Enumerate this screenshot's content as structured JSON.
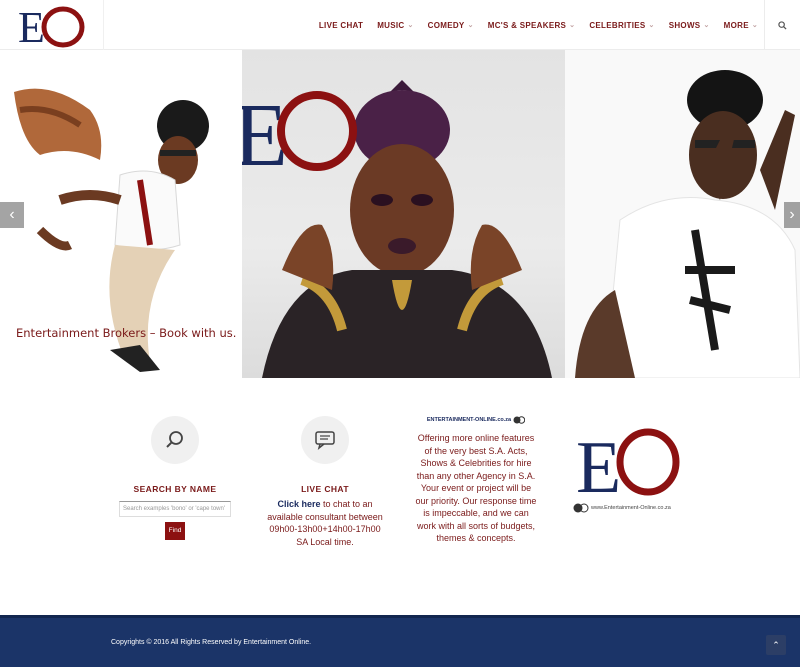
{
  "header": {
    "nav": [
      {
        "label": "LIVE CHAT",
        "has_dropdown": false
      },
      {
        "label": "MUSIC",
        "has_dropdown": true
      },
      {
        "label": "COMEDY",
        "has_dropdown": true
      },
      {
        "label": "MC'S & SPEAKERS",
        "has_dropdown": true
      },
      {
        "label": "CELEBRITIES",
        "has_dropdown": true
      },
      {
        "label": "SHOWS",
        "has_dropdown": true
      },
      {
        "label": "MORE",
        "has_dropdown": true
      }
    ],
    "search_icon": "search-icon",
    "logo_text": "EO"
  },
  "slider": {
    "caption": "Entertainment Brokers – Book with us.",
    "prev_icon": "chevron-left-icon",
    "next_icon": "chevron-right-icon",
    "logo_text": "EO"
  },
  "features": {
    "search": {
      "title": "SEARCH BY NAME",
      "placeholder": "Search examples 'bono' or 'cape town'",
      "button": "Find",
      "icon": "search-icon"
    },
    "chat": {
      "title": "LIVE CHAT",
      "link": "Click here",
      "text": " to chat to an available consultant between 09h00-13h00+14h00-17h00 SA Local time.",
      "icon": "chat-icon"
    },
    "info": {
      "banner": "ENTERTAINMENT-ONLINE.co.za",
      "text": "Offering more online features of the very best S.A. Acts, Shows & Celebrities for hire than any other Agency in S.A. Your event or project will be our priority. Our response time is impeccable, and we can work with all sorts of budgets, themes & concepts."
    },
    "brand": {
      "logo_text": "EO",
      "url": "www.Entertainment-Online.co.za"
    }
  },
  "footer": {
    "copyright": "Copyrights © 2016 All Rights Reserved by Entertainment Online.",
    "to_top_icon": "chevron-up-icon"
  },
  "colors": {
    "brand_blue": "#1a2a5e",
    "brand_red": "#8c1111",
    "footer_bg": "#1b3468"
  }
}
